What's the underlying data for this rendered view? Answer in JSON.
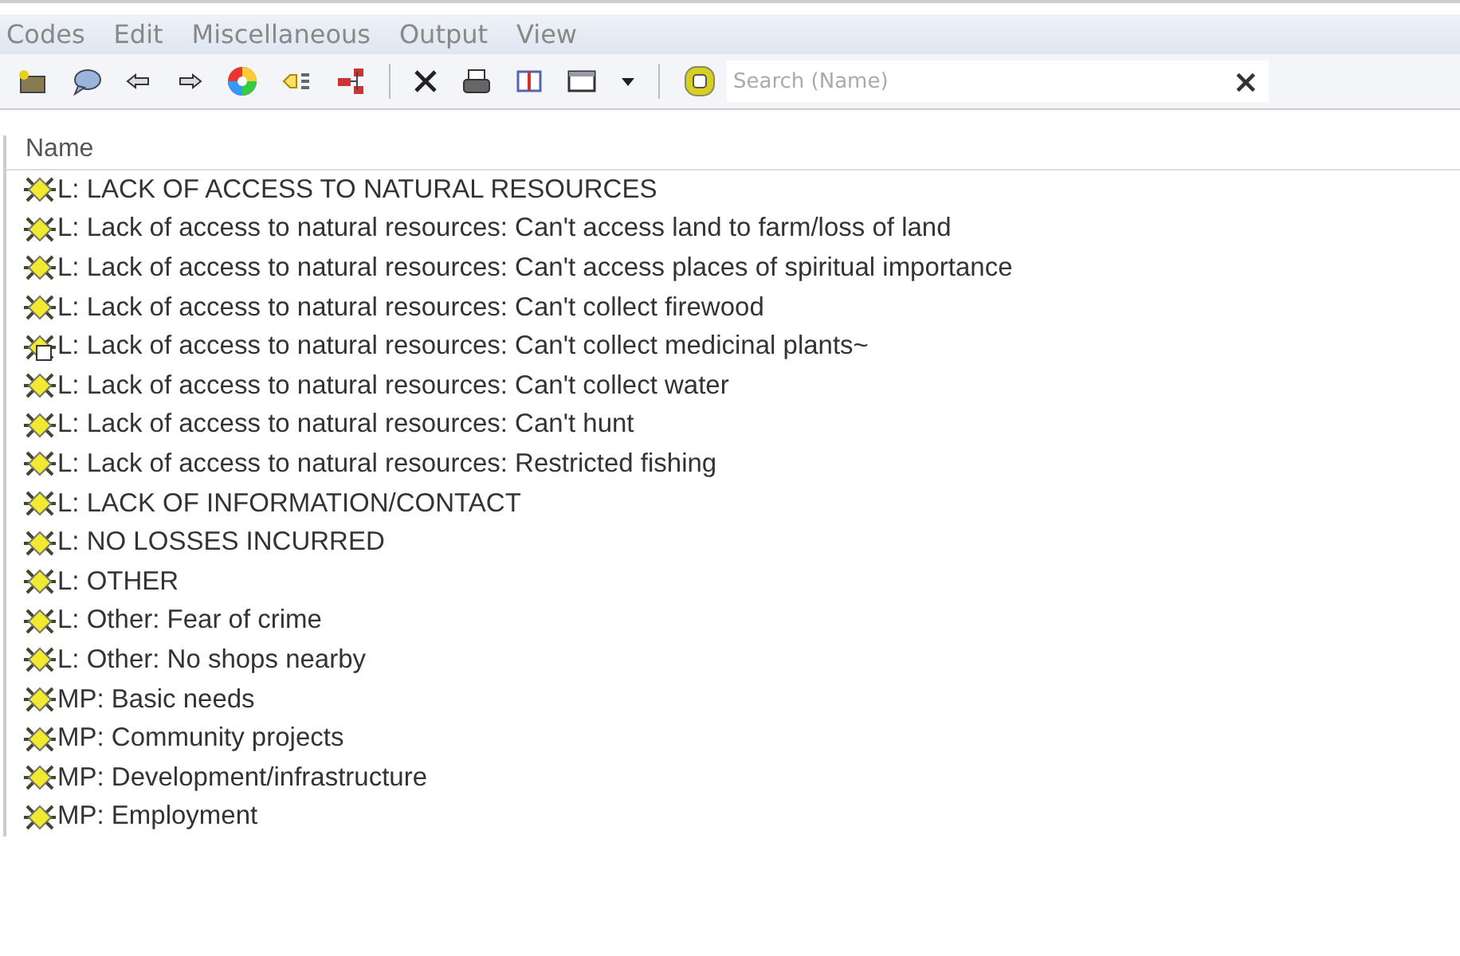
{
  "menu": [
    "Codes",
    "Edit",
    "Miscellaneous",
    "Output",
    "View"
  ],
  "search": {
    "placeholder": "Search (Name)",
    "clear": "×"
  },
  "table": {
    "columns": [
      "Name"
    ],
    "rows": [
      {
        "kind": "code",
        "name": "L: LACK OF ACCESS TO NATURAL RESOURCES"
      },
      {
        "kind": "code",
        "name": "L: Lack of access to natural resources: Can't access land to farm/loss of land"
      },
      {
        "kind": "code",
        "name": "L: Lack of access to natural resources: Can't access places of spiritual importance"
      },
      {
        "kind": "code",
        "name": "L: Lack of access to natural resources: Can't collect firewood"
      },
      {
        "kind": "memo",
        "name": "L: Lack of access to natural resources: Can't collect medicinal plants~"
      },
      {
        "kind": "code",
        "name": "L: Lack of access to natural resources: Can't collect water"
      },
      {
        "kind": "code",
        "name": "L: Lack of access to natural resources: Can't hunt"
      },
      {
        "kind": "code",
        "name": "L: Lack of access to natural resources: Restricted fishing"
      },
      {
        "kind": "code",
        "name": "L: LACK OF INFORMATION/CONTACT"
      },
      {
        "kind": "code",
        "name": "L: NO LOSSES INCURRED"
      },
      {
        "kind": "code",
        "name": "L: OTHER"
      },
      {
        "kind": "code",
        "name": "L: Other: Fear of crime"
      },
      {
        "kind": "code",
        "name": "L: Other: No shops nearby"
      },
      {
        "kind": "code",
        "name": "MP: Basic needs"
      },
      {
        "kind": "code",
        "name": "MP: Community projects"
      },
      {
        "kind": "code",
        "name": "MP: Development/infrastructure"
      },
      {
        "kind": "code",
        "name": "MP: Employment"
      }
    ]
  }
}
